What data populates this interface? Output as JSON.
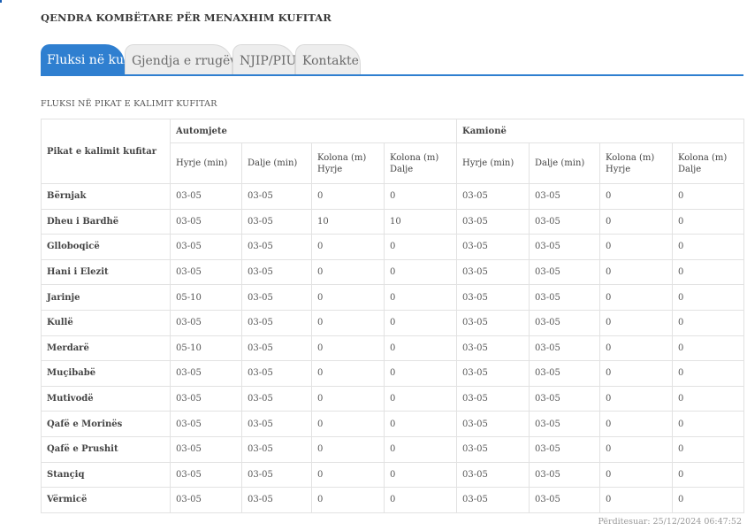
{
  "header": {
    "title": "QENDRA KOMBËTARE PËR MENAXHIM KUFITAR"
  },
  "tabs": [
    {
      "label": "Fluksi në kufi",
      "active": true
    },
    {
      "label": "Gjendja e rrugëve",
      "active": false
    },
    {
      "label": "NJIP/PIU",
      "active": false
    },
    {
      "label": "Kontakte",
      "active": false
    }
  ],
  "section": {
    "title": "FLUKSI NË PIKAT E KALIMIT KUFITAR"
  },
  "table": {
    "corner_header": "Pikat e kalimit kufitar",
    "group_headers": [
      "Automjete",
      "Kamionë"
    ],
    "sub_headers": [
      "Hyrje (min)",
      "Dalje (min)",
      "Kolona (m) Hyrje",
      "Kolona (m) Dalje",
      "Hyrje (min)",
      "Dalje (min)",
      "Kolona (m) Hyrje",
      "Kolona (m) Dalje"
    ],
    "rows": [
      {
        "name": "Bërnjak",
        "cells": [
          "03-05",
          "03-05",
          "0",
          "0",
          "03-05",
          "03-05",
          "0",
          "0"
        ]
      },
      {
        "name": "Dheu i Bardhë",
        "cells": [
          "03-05",
          "03-05",
          "10",
          "10",
          "03-05",
          "03-05",
          "0",
          "0"
        ]
      },
      {
        "name": "Glloboqicë",
        "cells": [
          "03-05",
          "03-05",
          "0",
          "0",
          "03-05",
          "03-05",
          "0",
          "0"
        ]
      },
      {
        "name": "Hani i Elezit",
        "cells": [
          "03-05",
          "03-05",
          "0",
          "0",
          "03-05",
          "03-05",
          "0",
          "0"
        ]
      },
      {
        "name": "Jarinje",
        "cells": [
          "05-10",
          "03-05",
          "0",
          "0",
          "03-05",
          "03-05",
          "0",
          "0"
        ]
      },
      {
        "name": "Kullë",
        "cells": [
          "03-05",
          "03-05",
          "0",
          "0",
          "03-05",
          "03-05",
          "0",
          "0"
        ]
      },
      {
        "name": "Merdarë",
        "cells": [
          "05-10",
          "03-05",
          "0",
          "0",
          "03-05",
          "03-05",
          "0",
          "0"
        ]
      },
      {
        "name": "Muçibabë",
        "cells": [
          "03-05",
          "03-05",
          "0",
          "0",
          "03-05",
          "03-05",
          "0",
          "0"
        ]
      },
      {
        "name": "Mutivodë",
        "cells": [
          "03-05",
          "03-05",
          "0",
          "0",
          "03-05",
          "03-05",
          "0",
          "0"
        ]
      },
      {
        "name": "Qafë e Morinës",
        "cells": [
          "03-05",
          "03-05",
          "0",
          "0",
          "03-05",
          "03-05",
          "0",
          "0"
        ]
      },
      {
        "name": "Qafë e Prushit",
        "cells": [
          "03-05",
          "03-05",
          "0",
          "0",
          "03-05",
          "03-05",
          "0",
          "0"
        ]
      },
      {
        "name": "Stançiq",
        "cells": [
          "03-05",
          "03-05",
          "0",
          "0",
          "03-05",
          "03-05",
          "0",
          "0"
        ]
      },
      {
        "name": "Vërmicë",
        "cells": [
          "03-05",
          "03-05",
          "0",
          "0",
          "03-05",
          "03-05",
          "0",
          "0"
        ]
      }
    ]
  },
  "footer": {
    "updated": "Përditesuar: 25/12/2024 06:47:52"
  },
  "colors": {
    "accent": "#2f7fd0",
    "tab_inactive": "#ededed",
    "border": "#e2e2e2"
  }
}
